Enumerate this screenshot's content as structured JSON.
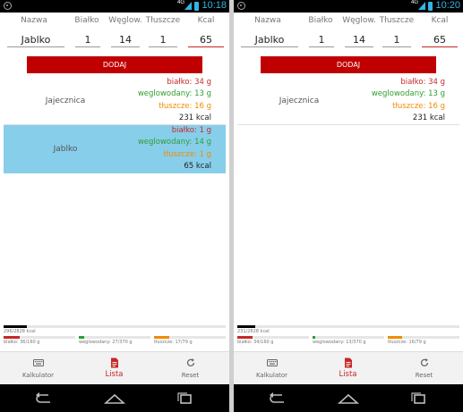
{
  "screens": [
    {
      "status": {
        "time": "10:18",
        "network": "4G"
      },
      "headers": {
        "name": "Nazwa",
        "protein": "Białko",
        "carbs": "Węglow.",
        "fat": "Tłuszcze",
        "kcal": "Kcal"
      },
      "inputs": {
        "name": "Jablko",
        "protein": "1",
        "carbs": "14",
        "fat": "1",
        "kcal": "65"
      },
      "add_button": "DODAJ",
      "items": [
        {
          "name": "Jajecznica",
          "protein": "białko: 34 g",
          "carbs": "weglowodany: 13 g",
          "fat": "tłuszcze: 16 g",
          "kcal": "231 kcal",
          "selected": false
        },
        {
          "name": "Jablko",
          "protein": "białko: 1 g",
          "carbs": "weglowodany: 14 g",
          "fat": "tłuszcze: 1 g",
          "kcal": "65 kcal",
          "selected": true
        }
      ],
      "progress": {
        "kcal": {
          "label": "296/2828 kcal",
          "fraction": 0.105,
          "color": "#000000"
        },
        "protein": {
          "label": "białko: 36/160 g",
          "fraction": 0.225,
          "color": "#c62828"
        },
        "carbs": {
          "label": "weglowodany: 27/370 g",
          "fraction": 0.073,
          "color": "#2e9e2e"
        },
        "fat": {
          "label": "tłuszcze: 17/79 g",
          "fraction": 0.215,
          "color": "#f08c00"
        }
      },
      "tabs": {
        "calculator": "Kalkulator",
        "list": "Lista",
        "reset": "Reset"
      }
    },
    {
      "status": {
        "time": "10:20",
        "network": "4G"
      },
      "headers": {
        "name": "Nazwa",
        "protein": "Białko",
        "carbs": "Węglow.",
        "fat": "Tłuszcze",
        "kcal": "Kcal"
      },
      "inputs": {
        "name": "Jablko",
        "protein": "1",
        "carbs": "14",
        "fat": "1",
        "kcal": "65"
      },
      "add_button": "DODAJ",
      "items": [
        {
          "name": "Jajecznica",
          "protein": "białko: 34 g",
          "carbs": "weglowodany: 13 g",
          "fat": "tłuszcze: 16 g",
          "kcal": "231 kcal",
          "selected": false
        }
      ],
      "progress": {
        "kcal": {
          "label": "231/2828 kcal",
          "fraction": 0.082,
          "color": "#000000"
        },
        "protein": {
          "label": "białko: 34/160 g",
          "fraction": 0.213,
          "color": "#c62828"
        },
        "carbs": {
          "label": "weglowodany: 13/370 g",
          "fraction": 0.035,
          "color": "#2e9e2e"
        },
        "fat": {
          "label": "tłuszcze: 16/79 g",
          "fraction": 0.203,
          "color": "#f08c00"
        }
      },
      "tabs": {
        "calculator": "Kalkulator",
        "list": "Lista",
        "reset": "Reset"
      }
    }
  ]
}
